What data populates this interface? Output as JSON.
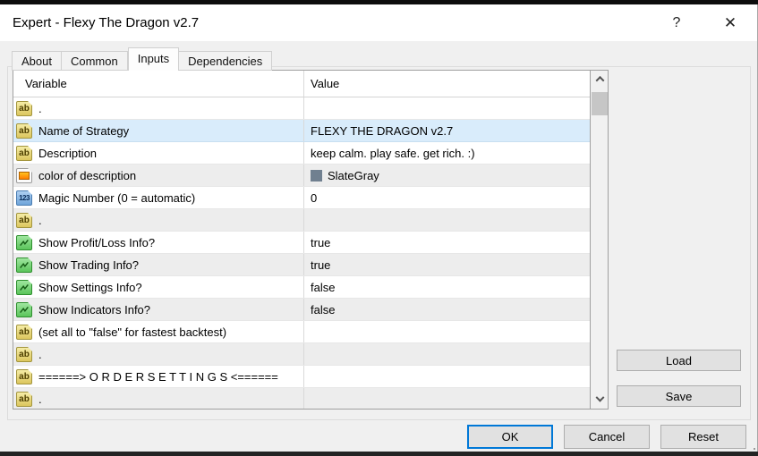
{
  "window": {
    "title": "Expert - Flexy The Dragon v2.7",
    "help_glyph": "?",
    "close_glyph": "✕"
  },
  "tabs": [
    {
      "label": "About",
      "active": false
    },
    {
      "label": "Common",
      "active": false
    },
    {
      "label": "Inputs",
      "active": true
    },
    {
      "label": "Dependencies",
      "active": false
    }
  ],
  "table": {
    "columns": [
      "Variable",
      "Value"
    ],
    "rows": [
      {
        "icon": "text",
        "variable": ".",
        "value": ""
      },
      {
        "icon": "text",
        "variable": "Name of Strategy",
        "value": "FLEXY THE DRAGON v2.7",
        "state": "selected"
      },
      {
        "icon": "text",
        "variable": "Description",
        "value": "keep calm. play safe. get rich. :)"
      },
      {
        "icon": "color",
        "variable": "color of description",
        "value": "SlateGray",
        "swatch": "#708090"
      },
      {
        "icon": "number",
        "variable": "Magic Number (0 = automatic)",
        "value": "0"
      },
      {
        "icon": "text",
        "variable": ".",
        "value": ""
      },
      {
        "icon": "bool",
        "variable": "Show Profit/Loss Info?",
        "value": "true"
      },
      {
        "icon": "bool",
        "variable": "Show Trading Info?",
        "value": "true"
      },
      {
        "icon": "bool",
        "variable": "Show Settings Info?",
        "value": "false"
      },
      {
        "icon": "bool",
        "variable": "Show Indicators Info?",
        "value": "false"
      },
      {
        "icon": "text",
        "variable": "(set all to \"false\" for fastest backtest)",
        "value": ""
      },
      {
        "icon": "text",
        "variable": ".",
        "value": ""
      },
      {
        "icon": "text",
        "variable": "======> O R D E R  S E T T I N G S <======",
        "value": ""
      },
      {
        "icon": "text",
        "variable": ".",
        "value": ""
      }
    ]
  },
  "icons": {
    "text_param_glyph": "ab",
    "number_param_glyph": "123",
    "bool_param": "line-chart",
    "color_param": "color-swatch",
    "scroll_up": "chevron-up",
    "scroll_down": "chevron-down"
  },
  "buttons": {
    "load": "Load",
    "save": "Save",
    "ok": "OK",
    "cancel": "Cancel",
    "reset": "Reset"
  },
  "colors": {
    "accent": "#0078d7",
    "selection_bg": "#d9ecfb",
    "slategray_value": "#708090"
  }
}
